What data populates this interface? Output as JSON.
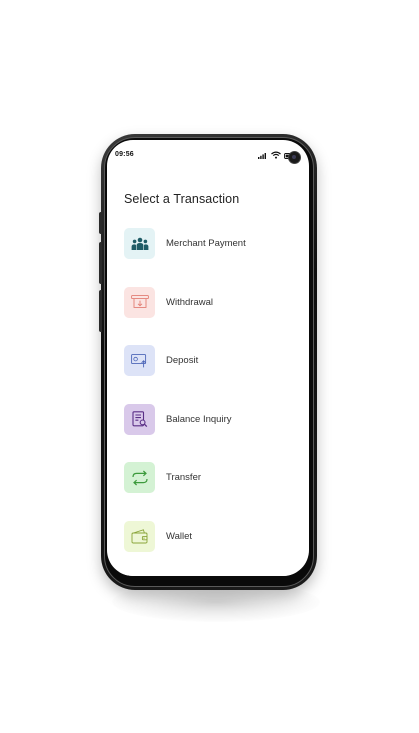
{
  "status_bar": {
    "time": "09:56"
  },
  "screen": {
    "title": "Select a Transaction"
  },
  "transactions": [
    {
      "label": "Merchant Payment",
      "icon": "people-group-icon",
      "bg": "#e4f3f5",
      "color": "#1f5c66"
    },
    {
      "label": "Withdrawal",
      "icon": "cash-withdraw-icon",
      "bg": "#fbe4e2",
      "color": "#e27e74"
    },
    {
      "label": "Deposit",
      "icon": "cash-deposit-icon",
      "bg": "#dde3f7",
      "color": "#4e67b8"
    },
    {
      "label": "Balance Inquiry",
      "icon": "document-search-icon",
      "bg": "#d9c9ea",
      "color": "#5a2e86"
    },
    {
      "label": "Transfer",
      "icon": "transfer-arrows-icon",
      "bg": "#d4f2d4",
      "color": "#3c9a3c"
    },
    {
      "label": "Wallet",
      "icon": "wallet-icon",
      "bg": "#eef7d6",
      "color": "#8aa53a"
    }
  ]
}
